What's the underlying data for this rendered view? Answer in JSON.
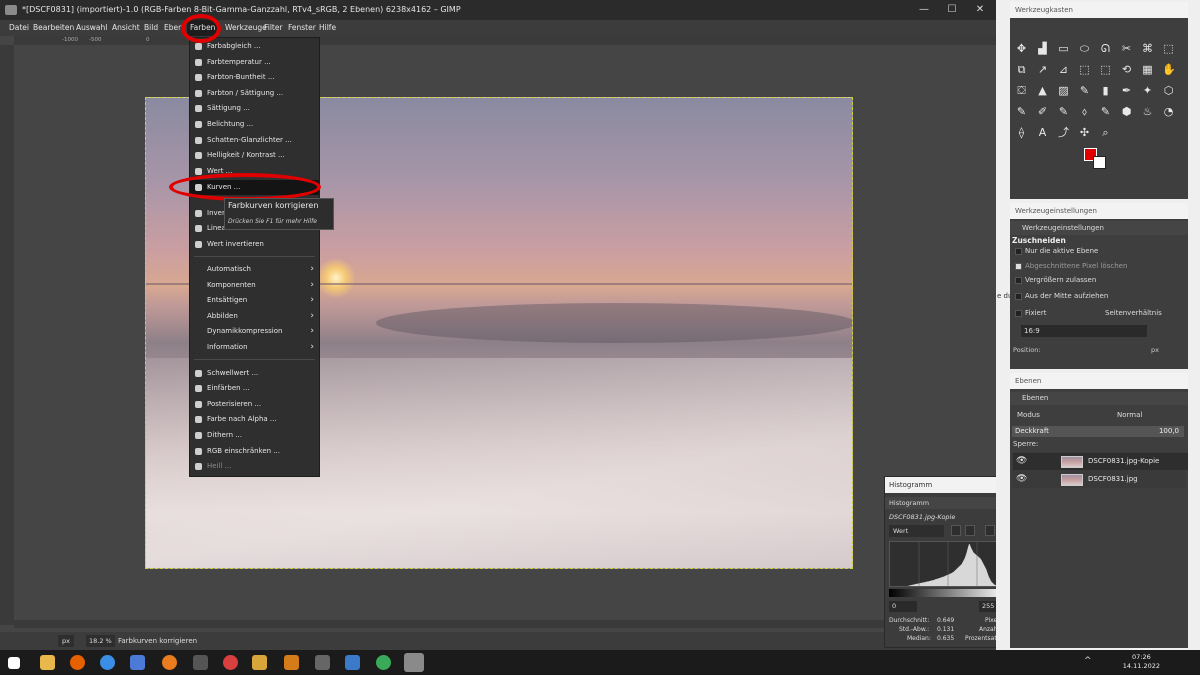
{
  "window": {
    "title": "*[DSCF0831] (importiert)-1.0 (RGB-Farben 8-Bit-Gamma-Ganzzahl, RTv4_sRGB, 2 Ebenen) 6238x4162 – GIMP",
    "minimize": "—",
    "maximize": "☐",
    "close": "✕"
  },
  "menubar": [
    "Datei",
    "Bearbeiten",
    "Auswahl",
    "Ansicht",
    "Bild",
    "Eben",
    "Farben",
    "Werkzeuge",
    "Filter",
    "Fenster",
    "Hilfe"
  ],
  "ruler": [
    "-1000",
    "-500",
    "0",
    "500",
    "1000"
  ],
  "colors_menu": {
    "items": [
      {
        "label": "Farbabgleich ...",
        "dim": false
      },
      {
        "label": "Farbtemperatur ...",
        "dim": false
      },
      {
        "label": "Farbton-Buntheit ...",
        "dim": false
      },
      {
        "label": "Farbton / Sättigung ...",
        "dim": false
      },
      {
        "label": "Sättigung ...",
        "dim": false
      },
      {
        "label": "Belichtung ...",
        "dim": false
      },
      {
        "label": "Schatten-Glanzlichter ...",
        "dim": false
      },
      {
        "label": "Helligkeit / Kontrast ...",
        "dim": false
      },
      {
        "label": "Wert ...",
        "dim": false
      },
      {
        "label": "Kurven ...",
        "dim": false,
        "highlighted": true
      },
      {
        "label": "Invert",
        "dim": false
      },
      {
        "label": "Linea",
        "dim": false
      },
      {
        "label": "Wert invertieren",
        "dim": false
      }
    ],
    "submenus": [
      "Automatisch",
      "Komponenten",
      "Entsättigen",
      "Abbilden",
      "Dynamikkompression",
      "Information"
    ],
    "items2": [
      {
        "label": "Schwellwert ...",
        "dim": false
      },
      {
        "label": "Einfärben ...",
        "dim": false
      },
      {
        "label": "Posterisieren ...",
        "dim": false
      },
      {
        "label": "Farbe nach Alpha ...",
        "dim": false
      },
      {
        "label": "Dithern ...",
        "dim": false
      },
      {
        "label": "RGB einschränken ...",
        "dim": false
      },
      {
        "label": "Heill ...",
        "dim": true
      }
    ],
    "submenu_arrow": "›"
  },
  "tooltip": {
    "title": "Farbkurven korrigieren",
    "hint": "Drücken Sie F1 für mehr Hilfe"
  },
  "statusbar": {
    "unit": "px",
    "zoom": "18.2 %",
    "message": "Farbkurven korrigieren"
  },
  "histogram": {
    "window_title": "Histogramm",
    "tab": "Histogramm",
    "layer": "DSCF0831.jpg-Kopie",
    "channel": "Wert",
    "range_min": "0",
    "range_max": "255",
    "stats": {
      "mean_label": "Durchschnitt:",
      "mean": "0.649",
      "std_label": "Std.-Abw.:",
      "std": "0.131",
      "median_label": "Median:",
      "median": "0.635",
      "pixels_label": "Pixel:",
      "count_label": "Anzahl:",
      "percent_label": "Prozentsatz:"
    },
    "bins": [
      0,
      0,
      0,
      0,
      0,
      0,
      0,
      0,
      0,
      0,
      0,
      0,
      0,
      0,
      0,
      0,
      0,
      0,
      0,
      0,
      0,
      0,
      0,
      0,
      0,
      0,
      0,
      0,
      0,
      0,
      0,
      0,
      0,
      0,
      0,
      0,
      0,
      0,
      0,
      0,
      0,
      0,
      1,
      1,
      1,
      1,
      2,
      2,
      2,
      2,
      3,
      3,
      3,
      3,
      4,
      4,
      4,
      4,
      5,
      5,
      5,
      5,
      5,
      6,
      6,
      6,
      6,
      6,
      7,
      7,
      7,
      7,
      8,
      8,
      8,
      8,
      9,
      9,
      9,
      9,
      9,
      10,
      10,
      10,
      10,
      11,
      11,
      11,
      11,
      12,
      12,
      12,
      12,
      13,
      13,
      13,
      13,
      14,
      14,
      14,
      14,
      15,
      15,
      16,
      16,
      16,
      17,
      17,
      17,
      18,
      18,
      18,
      19,
      19,
      19,
      20,
      20,
      21,
      21,
      21,
      22,
      22,
      22,
      23,
      23,
      24,
      24,
      25,
      25,
      26,
      26,
      26,
      27,
      27,
      28,
      28,
      29,
      29,
      30,
      30,
      31,
      31,
      32,
      33,
      33,
      34,
      35,
      36,
      37,
      38,
      39,
      40,
      41,
      42,
      43,
      44,
      45,
      46,
      47,
      48,
      49,
      50,
      51,
      52,
      54,
      56,
      58,
      60,
      62,
      64,
      66,
      69,
      72,
      75,
      78,
      82,
      86,
      90,
      94,
      97,
      100,
      100,
      98,
      95,
      93,
      90,
      88,
      86,
      84,
      82,
      80,
      79,
      78,
      77,
      76,
      75,
      74,
      73,
      73,
      72,
      71,
      70,
      69,
      68,
      67,
      66,
      65,
      64,
      62,
      60,
      58,
      56,
      54,
      52,
      50,
      48,
      46,
      44,
      42,
      40,
      37,
      34,
      31,
      28,
      25,
      22,
      20,
      18,
      16,
      14,
      12,
      10,
      9,
      8,
      7,
      6,
      5,
      4,
      3,
      3,
      2,
      2,
      2,
      1,
      1,
      1,
      1,
      1,
      0,
      0,
      0,
      0,
      0,
      0,
      0,
      0,
      0,
      0,
      0,
      0,
      0,
      0,
      0,
      0,
      0
    ]
  },
  "toolbox": {
    "title": "Werkzeugkasten",
    "icons": [
      "✥",
      "▟",
      "▭",
      "⬭",
      "ᘏ",
      "✂",
      "⌘",
      "⬚",
      "⧉",
      "↗",
      "⊿",
      "⬚",
      "⬚",
      "⟲",
      "▦",
      "✋",
      "⛋",
      "▲",
      "▨",
      "✎",
      "▮",
      "✒",
      "✦",
      "⬡",
      "✎",
      "✐",
      "✎",
      "⬨",
      "✎",
      "⬢",
      "♨",
      "◔",
      "⟠",
      "A",
      "⤴",
      "✣",
      "⌕"
    ],
    "fg_color": "#e00000",
    "bg_color": "#ffffff"
  },
  "tool_options": {
    "window_title": "Werkzeugeinstellungen",
    "tab": "Werkzeugeinstellungen",
    "heading": "Zuschneiden",
    "options": [
      {
        "label": "Nur die aktive Ebene",
        "checked": false,
        "dim": false
      },
      {
        "label": "Abgeschnittene Pixel löschen",
        "checked": true,
        "dim": true
      },
      {
        "label": "Vergrößern zulassen",
        "checked": false,
        "dim": false
      },
      {
        "label": "Aus der Mitte aufziehen",
        "checked": false,
        "dim": false
      }
    ],
    "fixed_label": "Fixiert",
    "fixed_value": "Seitenverhältnis",
    "ratio": "16:9",
    "position_label": "Position:",
    "position_unit": "px"
  },
  "layers": {
    "window_title": "Ebenen",
    "tab": "Ebenen",
    "mode_label": "Modus",
    "mode_value": "Normal",
    "opacity_label": "Deckkraft",
    "opacity_value": "100,0",
    "lock_label": "Sperre:",
    "items": [
      {
        "name": "DSCF0831.jpg-Kopie",
        "selected": true
      },
      {
        "name": "DSCF0831.jpg",
        "selected": false
      }
    ]
  },
  "side_fragment": "e du",
  "taskbar": {
    "time": "07:26",
    "date": "14.11.2022",
    "tray": "^"
  }
}
